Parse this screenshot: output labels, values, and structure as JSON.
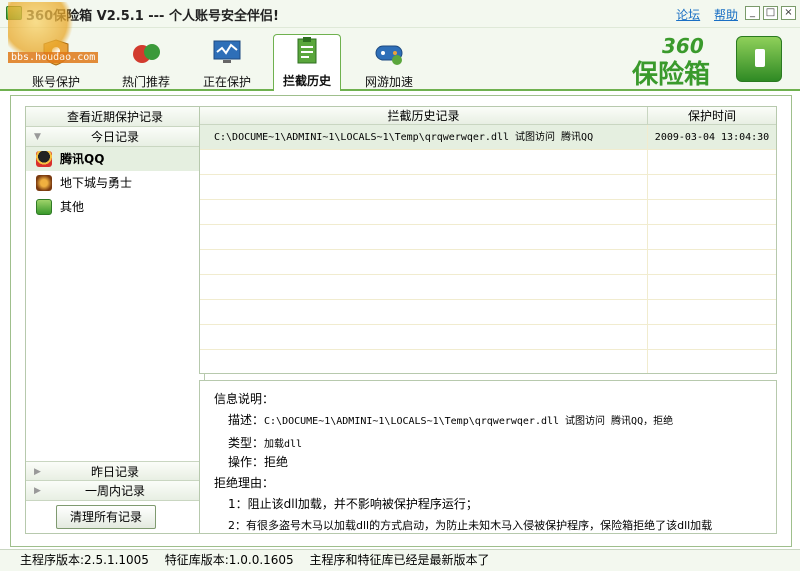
{
  "window": {
    "title": "360保险箱 V2.5.1 --- 个人账号安全伴侣!",
    "links": {
      "forum": "论坛",
      "help": "帮助"
    },
    "controls": {
      "minimize": "_",
      "maximize": "□",
      "close": "×"
    }
  },
  "watermark": {
    "site": "bbs.houdao.com"
  },
  "tabs": [
    {
      "label": "账号保护",
      "icon": "account-shield-icon"
    },
    {
      "label": "热门推荐",
      "icon": "recommend-icon"
    },
    {
      "label": "正在保护",
      "icon": "monitor-icon"
    },
    {
      "label": "拦截历史",
      "icon": "history-clipboard-icon",
      "active": true
    },
    {
      "label": "网游加速",
      "icon": "gamepad-icon"
    }
  ],
  "brand": {
    "number": "360",
    "name": "保险箱"
  },
  "left_panel": {
    "header": "查看近期保护记录",
    "today_section": "今日记录",
    "items": [
      {
        "label": "腾讯QQ",
        "selected": true,
        "icon": "qq-penguin-icon"
      },
      {
        "label": "地下城与勇士",
        "selected": false,
        "icon": "dnf-game-icon"
      },
      {
        "label": "其他",
        "selected": false,
        "icon": "other-app-icon"
      }
    ],
    "yesterday_section": "昨日记录",
    "week_section": "一周内记录",
    "clear_button": "清理所有记录"
  },
  "grid": {
    "columns": [
      "拦截历史记录",
      "保护时间"
    ],
    "rows": [
      {
        "record": "C:\\DOCUME~1\\ADMINI~1\\LOCALS~1\\Temp\\qrqwerwqer.dll 试图访问 腾讯QQ",
        "time": "2009-03-04 13:04:30"
      }
    ]
  },
  "info": {
    "heading": "信息说明：",
    "desc_label": "描述：",
    "desc_value": "C:\\DOCUME~1\\ADMINI~1\\LOCALS~1\\Temp\\qrqwerwqer.dll 试图访问 腾讯QQ，拒绝",
    "type_label": "类型：",
    "type_value": "加载dll",
    "action_label": "操作：",
    "action_value": "拒绝",
    "reason_heading": "拒绝理由：",
    "reason1": "1：阻止该dll加载，并不影响被保护程序运行；",
    "reason2": "2：有很多盗号木马以加载dll的方式启动，为防止未知木马入侵被保护程序，保险箱拒绝了该dll加载"
  },
  "status": {
    "main_version": "主程序版本:2.5.1.1005",
    "sig_version": "特征库版本:1.0.0.1605",
    "message": "主程序和特征库已经是最新版本了"
  }
}
